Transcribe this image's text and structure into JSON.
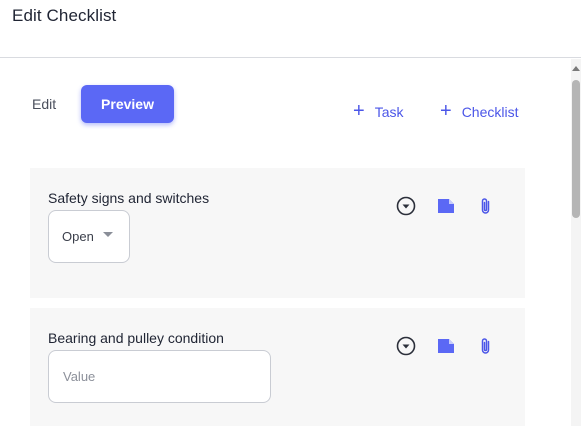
{
  "header": {
    "title": "Edit Checklist"
  },
  "tabs": {
    "edit_label": "Edit",
    "preview_label": "Preview"
  },
  "actions": {
    "task_label": "Task",
    "checklist_label": "Checklist",
    "plus_symbol": "+"
  },
  "items": [
    {
      "title": "Safety signs and switches",
      "control": "select",
      "selected_value": "Open"
    },
    {
      "title": "Bearing and pulley condition",
      "control": "input",
      "value": "",
      "placeholder": "Value"
    }
  ],
  "colors": {
    "accent": "#5b68f5",
    "link": "#4b56e8",
    "card_bg": "#f7f7f7"
  },
  "icons": [
    "chevron-circle-down-icon",
    "note-icon",
    "paperclip-icon"
  ]
}
